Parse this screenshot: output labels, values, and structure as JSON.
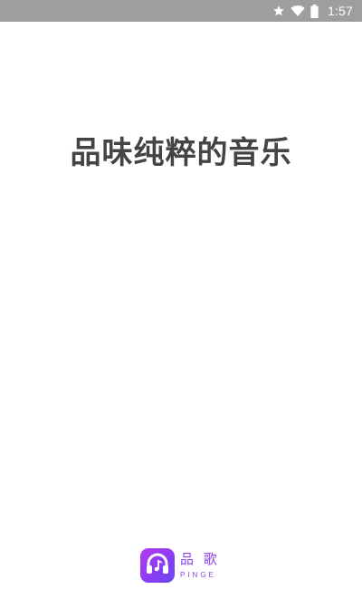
{
  "status_bar": {
    "time": "1:57",
    "icons": [
      "star-icon",
      "wifi-icon",
      "battery-icon"
    ]
  },
  "splash": {
    "slogan": "品味纯粹的音乐"
  },
  "brand": {
    "name": "品 歌",
    "subtitle": "PINGE",
    "logo_icon": "headphones-music-icon",
    "accent_color": "#8e44e8"
  }
}
